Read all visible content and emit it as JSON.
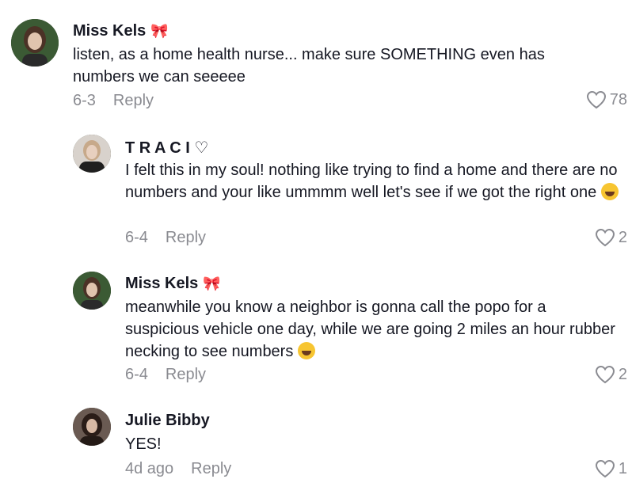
{
  "comments": [
    {
      "author": "Miss Kels",
      "text": "listen, as a home health nurse... make sure SOMETHING even has numbers we can seeeee",
      "date": "6-3",
      "reply_label": "Reply",
      "likes": "78"
    },
    {
      "author": "T R A C I ♡",
      "text": "I felt this in my soul! nothing like trying to find a home and there are no numbers and your like ummmm well let's see if we got the right one",
      "date": "6-4",
      "reply_label": "Reply",
      "likes": "2"
    },
    {
      "author": "Miss Kels",
      "text": "meanwhile you know a neighbor is gonna call the popo for a suspicious vehicle one day, while we are going 2 miles an hour rubber necking to see numbers",
      "date": "6-4",
      "reply_label": "Reply",
      "likes": "2"
    },
    {
      "author": "Julie Bibby",
      "text": "YES!",
      "date": "4d ago",
      "reply_label": "Reply",
      "likes": "1"
    }
  ],
  "icons": {
    "ribbon": "ribbon-emoji",
    "like": "heart-icon",
    "emoji": "laughing-emoji"
  },
  "colors": {
    "text": "#161823",
    "secondary": "#8a8b91",
    "ribbon": "#c2185b"
  }
}
